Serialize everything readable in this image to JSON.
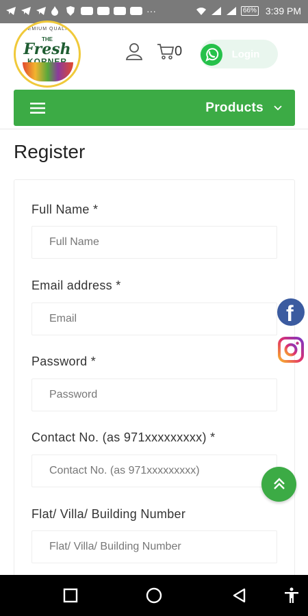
{
  "status_bar": {
    "time": "3:39 PM",
    "battery": "66%"
  },
  "header": {
    "logo": {
      "ring_text": "PREMIUM QUALITY",
      "the": "THE",
      "brand_top": "Fresh",
      "brand_bottom": "KORNER"
    },
    "cart_count": "0",
    "login_label": "Login"
  },
  "navbar": {
    "title": "Products"
  },
  "page": {
    "title": "Register"
  },
  "form": {
    "fields": [
      {
        "label": "Full Name *",
        "placeholder": "Full Name"
      },
      {
        "label": "Email address *",
        "placeholder": "Email"
      },
      {
        "label": "Password *",
        "placeholder": "Password"
      },
      {
        "label": "Contact No. (as 971xxxxxxxxx) *",
        "placeholder": "Contact No. (as 971xxxxxxxxx)"
      },
      {
        "label": "Flat/ Villa/ Building Number",
        "placeholder": "Flat/ Villa/ Building Number"
      }
    ]
  },
  "colors": {
    "brand_green": "#3cab45",
    "facebook": "#3b5ba0",
    "statusbar": "#7a7a7a"
  },
  "icons": [
    "user-icon",
    "cart-icon",
    "whatsapp-icon",
    "menu-icon",
    "chevron-down-icon",
    "facebook-icon",
    "instagram-icon",
    "scroll-up-icon",
    "recent-apps-icon",
    "home-icon",
    "back-icon",
    "accessibility-icon"
  ]
}
